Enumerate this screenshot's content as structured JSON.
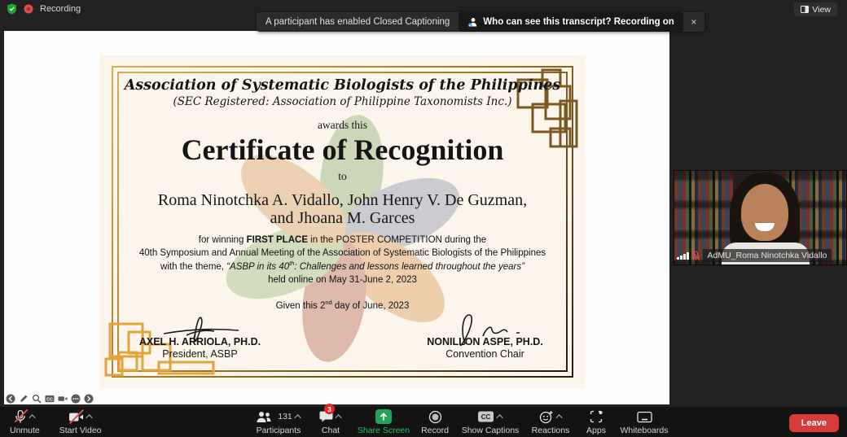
{
  "topbar": {
    "recording_label": "Recording",
    "view_label": "View"
  },
  "banner": {
    "cc_message": "A participant has enabled Closed Captioning",
    "transcript_message": "Who can see this transcript? Recording on",
    "close_symbol": "×"
  },
  "certificate": {
    "org_name": "Association of Systematic Biologists of the Philippines",
    "org_subtitle": "(SEC Registered: Association of Philippine Taxonomists Inc.)",
    "awards_text": "awards this",
    "title": "Certificate of Recognition",
    "to_text": "to",
    "recipients_line1": "Roma Ninotchka A. Vidallo, John Henry V. De Guzman,",
    "recipients_line2": "and Jhoana M. Garces",
    "body": {
      "line1_pre": "for winning ",
      "line1_bold": "FIRST PLACE",
      "line1_post": " in the POSTER COMPETITION during the",
      "line2": "40th Symposium and Annual Meeting of the Association of Systematic Biologists of the Philippines",
      "line3_pre": "with the theme, ",
      "theme_open": "“ASBP in its 40",
      "theme_sup": "th",
      "theme_close": ": Challenges and lessons learned throughout the years”",
      "line4": "held online on May 31-June 2, 2023",
      "given_pre": "Given this 2",
      "given_sup": "nd",
      "given_post": " day of June, 2023"
    },
    "signatories": {
      "left": {
        "name": "AXEL H. ARRIOLA, PH.D.",
        "title": "President, ASBP"
      },
      "right": {
        "name": "NONILLON ASPE, PH.D.",
        "title": "Convention Chair"
      }
    }
  },
  "participant_video": {
    "name_label": "AdMU_Roma Ninotchka Vidallo"
  },
  "toolbar": {
    "unmute": "Unmute",
    "start_video": "Start Video",
    "participants": "Participants",
    "participants_count": "131",
    "chat": "Chat",
    "chat_badge": "3",
    "share_screen": "Share Screen",
    "record": "Record",
    "show_captions": "Show Captions",
    "reactions": "Reactions",
    "apps": "Apps",
    "whiteboards": "Whiteboards",
    "leave": "Leave"
  },
  "colors": {
    "share_green": "#23a559",
    "badge_red": "#e02828",
    "leave_red": "#d83b3b",
    "border_gold": "#d8ae52",
    "border_dark": "#241c12",
    "cert_paper": "#fbf5eb"
  }
}
